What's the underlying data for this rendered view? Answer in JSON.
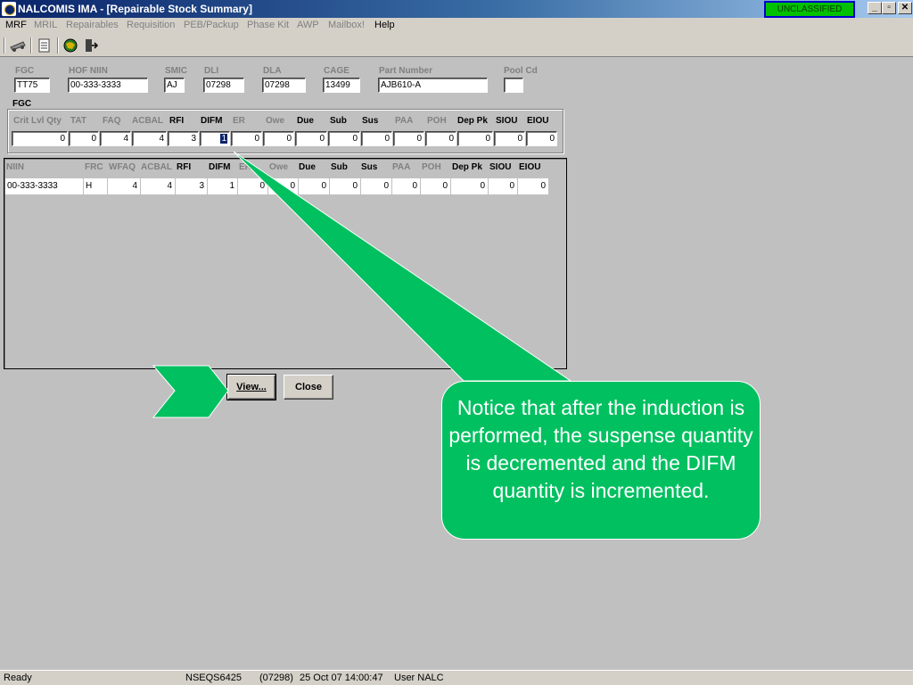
{
  "window": {
    "title": "NALCOMIS IMA - [Repairable Stock Summary]",
    "classification": "UNCLASSIFIED",
    "controls": [
      "_",
      "▫",
      "✕"
    ]
  },
  "menu": [
    {
      "label": "MRF",
      "enabled": true
    },
    {
      "label": "MRIL",
      "enabled": false
    },
    {
      "label": "Repairables",
      "enabled": false
    },
    {
      "label": "Requisition",
      "enabled": false
    },
    {
      "label": "PEB/Packup",
      "enabled": false
    },
    {
      "label": "Phase Kit",
      "enabled": false
    },
    {
      "label": "AWP",
      "enabled": false
    },
    {
      "label": "Mailbox!",
      "enabled": false
    },
    {
      "label": "Help",
      "enabled": true
    }
  ],
  "toolbar": {
    "icons": [
      "truck-icon",
      "printer-icon",
      "globe-icon",
      "exit-door-icon"
    ]
  },
  "header": {
    "fgc": {
      "label": "FGC",
      "value": "TT75"
    },
    "hof_niin": {
      "label": "HOF NIIN",
      "value": "00-333-3333"
    },
    "smic": {
      "label": "SMIC",
      "value": "AJ"
    },
    "dli": {
      "label": "DLI",
      "value": "07298"
    },
    "dla": {
      "label": "DLA",
      "value": "07298"
    },
    "cage": {
      "label": "CAGE",
      "value": "13499"
    },
    "part_number": {
      "label": "Part Number",
      "value": "AJB610-A"
    },
    "pool_cd": {
      "label": "Pool Cd",
      "value": ""
    }
  },
  "fgc_group": {
    "title": "FGC",
    "columns": [
      {
        "label": "Crit Lvl Qty",
        "value": "0",
        "dim": true
      },
      {
        "label": "TAT",
        "value": "0",
        "dim": true
      },
      {
        "label": "FAQ",
        "value": "4",
        "dim": true
      },
      {
        "label": "ACBAL",
        "value": "4",
        "dim": true
      },
      {
        "label": "RFI",
        "value": "3",
        "dim": false
      },
      {
        "label": "DIFM",
        "value": "1",
        "dim": false
      },
      {
        "label": "ER",
        "value": "0",
        "dim": true
      },
      {
        "label": "Owe",
        "value": "0",
        "dim": true
      },
      {
        "label": "Due",
        "value": "0",
        "dim": false
      },
      {
        "label": "Sub",
        "value": "0",
        "dim": false
      },
      {
        "label": "Sus",
        "value": "0",
        "dim": false
      },
      {
        "label": "PAA",
        "value": "0",
        "dim": true
      },
      {
        "label": "POH",
        "value": "0",
        "dim": true
      },
      {
        "label": "Dep Pk",
        "value": "0",
        "dim": false
      },
      {
        "label": "SIOU",
        "value": "0",
        "dim": false
      },
      {
        "label": "EIOU",
        "value": "0",
        "dim": false
      }
    ]
  },
  "grid": {
    "columns": [
      {
        "label": "NIIN",
        "dim": true
      },
      {
        "label": "FRC",
        "dim": true
      },
      {
        "label": "WFAQ",
        "dim": true
      },
      {
        "label": "ACBAL",
        "dim": true
      },
      {
        "label": "RFI",
        "dim": false
      },
      {
        "label": "DIFM",
        "dim": false
      },
      {
        "label": "ER",
        "dim": true
      },
      {
        "label": "Owe",
        "dim": true
      },
      {
        "label": "Due",
        "dim": false
      },
      {
        "label": "Sub",
        "dim": false
      },
      {
        "label": "Sus",
        "dim": false
      },
      {
        "label": "PAA",
        "dim": true
      },
      {
        "label": "POH",
        "dim": true
      },
      {
        "label": "Dep Pk",
        "dim": false
      },
      {
        "label": "SIOU",
        "dim": false
      },
      {
        "label": "EIOU",
        "dim": false
      }
    ],
    "rows": [
      [
        "00-333-3333",
        "H",
        "4",
        "4",
        "3",
        "1",
        "0",
        "0",
        "0",
        "0",
        "0",
        "0",
        "0",
        "0",
        "0",
        "0"
      ]
    ]
  },
  "buttons": {
    "view": "View...",
    "close": "Close"
  },
  "callout": {
    "text": "Notice that after the induction is performed, the suspense quantity is decremented and the DIFM quantity is incremented.",
    "color": "#00c060"
  },
  "status": {
    "state": "Ready",
    "server": "NSEQS6425",
    "dli": "(07298)",
    "datetime": "25 Oct 07  14:00:47",
    "user": "User NALC"
  }
}
